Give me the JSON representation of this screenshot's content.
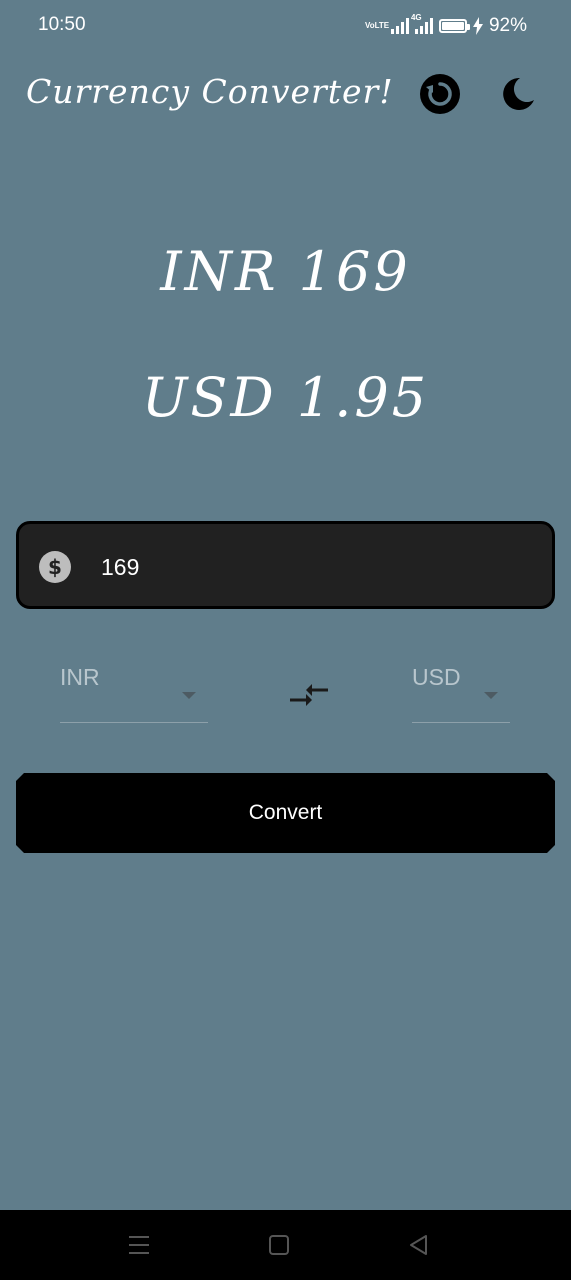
{
  "status_bar": {
    "time": "10:50",
    "network_label": "VoLTE",
    "network_type": "4G",
    "battery_percent": "92%",
    "battery_level": 0.92,
    "icons": [
      "volte-icon",
      "signal-icon",
      "signal-4g-icon",
      "battery-icon",
      "charging-icon"
    ]
  },
  "header": {
    "title": "Currency Converter!",
    "icons": [
      "refresh-icon",
      "moon-icon"
    ]
  },
  "result": {
    "from_display": "INR 169",
    "to_display": "USD 1.95"
  },
  "amount": {
    "value": "169",
    "icon": "dollar-icon"
  },
  "from_currency": {
    "selected": "INR"
  },
  "to_currency": {
    "selected": "USD"
  },
  "swap_icon": "swap-arrows-icon",
  "convert_button": {
    "label": "Convert"
  },
  "nav": {
    "icons": [
      "menu-icon",
      "home-icon",
      "back-icon"
    ]
  },
  "colors": {
    "background": "#607d8b",
    "field": "#212121",
    "button": "#000000",
    "text": "#ffffff"
  }
}
